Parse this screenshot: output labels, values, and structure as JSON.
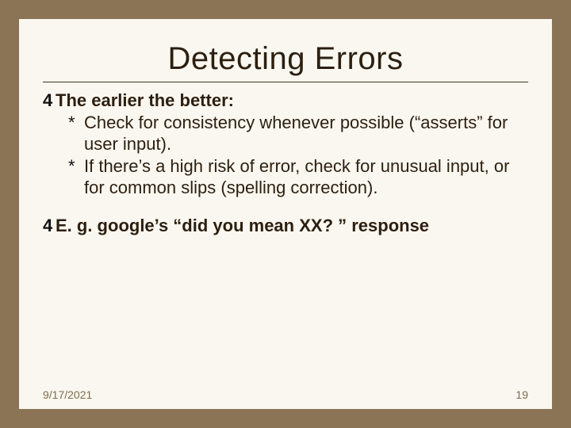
{
  "title": "Detecting Errors",
  "bullets": {
    "main_glyph": "4",
    "sub_glyph": "*"
  },
  "points": [
    {
      "head": "The earlier the better:",
      "subs": [
        "Check for consistency whenever possible (“asserts” for user input).",
        "If there’s a high risk of error, check for unusual input, or for common slips (spelling correction)."
      ]
    },
    {
      "head": "E. g. google’s “did you mean XX? ” response",
      "subs": []
    }
  ],
  "footer": {
    "date": "9/17/2021",
    "page": "19"
  }
}
